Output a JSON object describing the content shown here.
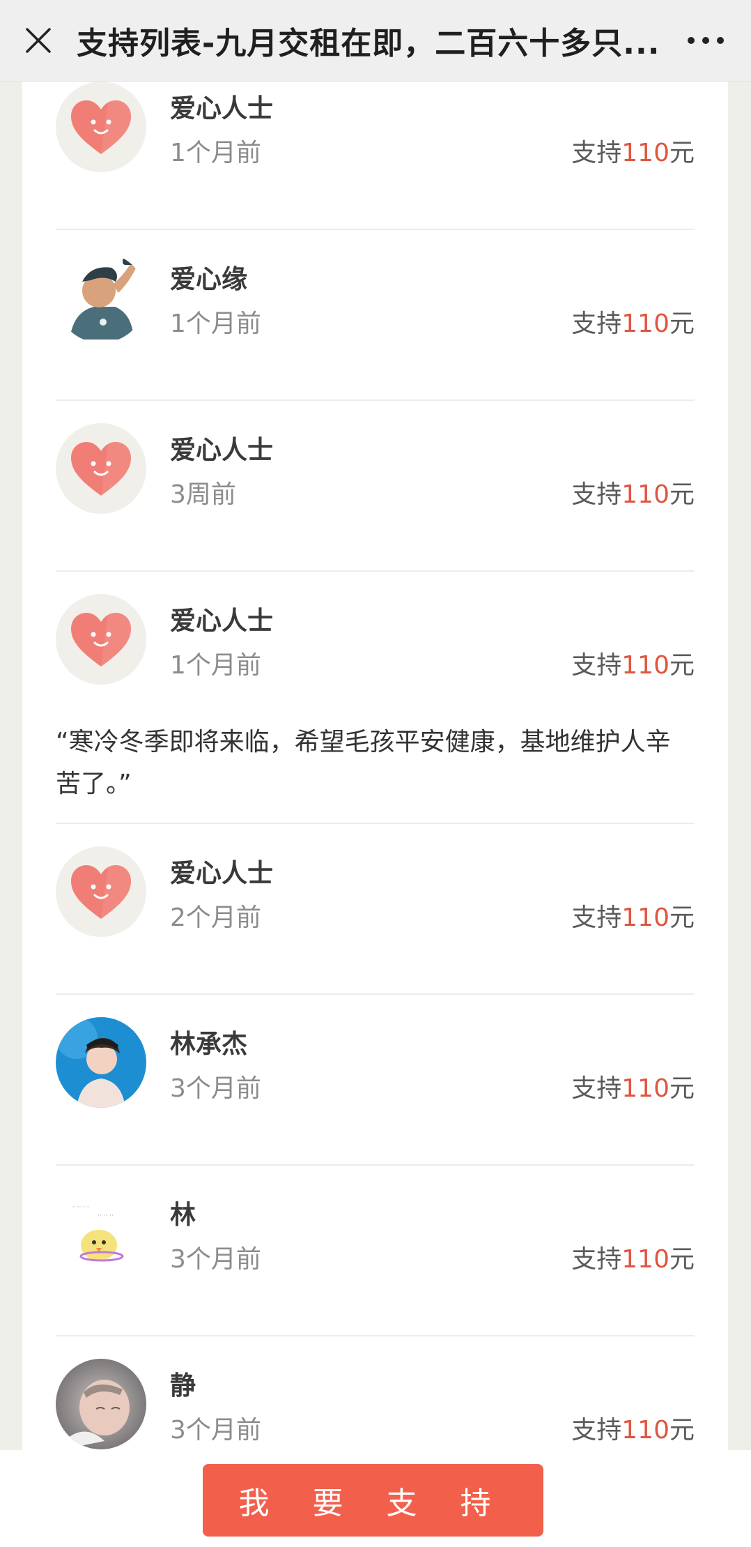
{
  "header": {
    "title": "支持列表-九月交租在即，二百六十多只...",
    "close_icon": "close-icon",
    "more_icon": "more-icon"
  },
  "supporters": [
    {
      "name": "爱心人士",
      "time": "1个月前",
      "amount_prefix": "支持",
      "amount": "110",
      "amount_suffix": "元",
      "avatar": "heart-avatar"
    },
    {
      "name": "爱心缘",
      "time": "1个月前",
      "amount_prefix": "支持",
      "amount": "110",
      "amount_suffix": "元",
      "avatar": "illustrated-man-avatar"
    },
    {
      "name": "爱心人士",
      "time": "3周前",
      "amount_prefix": "支持",
      "amount": "110",
      "amount_suffix": "元",
      "avatar": "heart-avatar"
    },
    {
      "name": "爱心人士",
      "time": "1个月前",
      "amount_prefix": "支持",
      "amount": "110",
      "amount_suffix": "元",
      "avatar": "heart-avatar",
      "message": "“寒冷冬季即将来临，希望毛孩平安健康，基地维护人辛苦了。”"
    },
    {
      "name": "爱心人士",
      "time": "2个月前",
      "amount_prefix": "支持",
      "amount": "110",
      "amount_suffix": "元",
      "avatar": "heart-avatar"
    },
    {
      "name": "林承杰",
      "time": "3个月前",
      "amount_prefix": "支持",
      "amount": "110",
      "amount_suffix": "元",
      "avatar": "woman-photo-avatar"
    },
    {
      "name": "林",
      "time": "3个月前",
      "amount_prefix": "支持",
      "amount": "110",
      "amount_suffix": "元",
      "avatar": "cartoon-chick-avatar"
    },
    {
      "name": "静",
      "time": "3个月前",
      "amount_prefix": "支持",
      "amount": "110",
      "amount_suffix": "元",
      "avatar": "baby-photo-avatar"
    }
  ],
  "footer": {
    "support_button": "我 要 支 持"
  },
  "colors": {
    "accent": "#f2604b",
    "amount": "#e0553f",
    "heart": "#f07e76"
  }
}
